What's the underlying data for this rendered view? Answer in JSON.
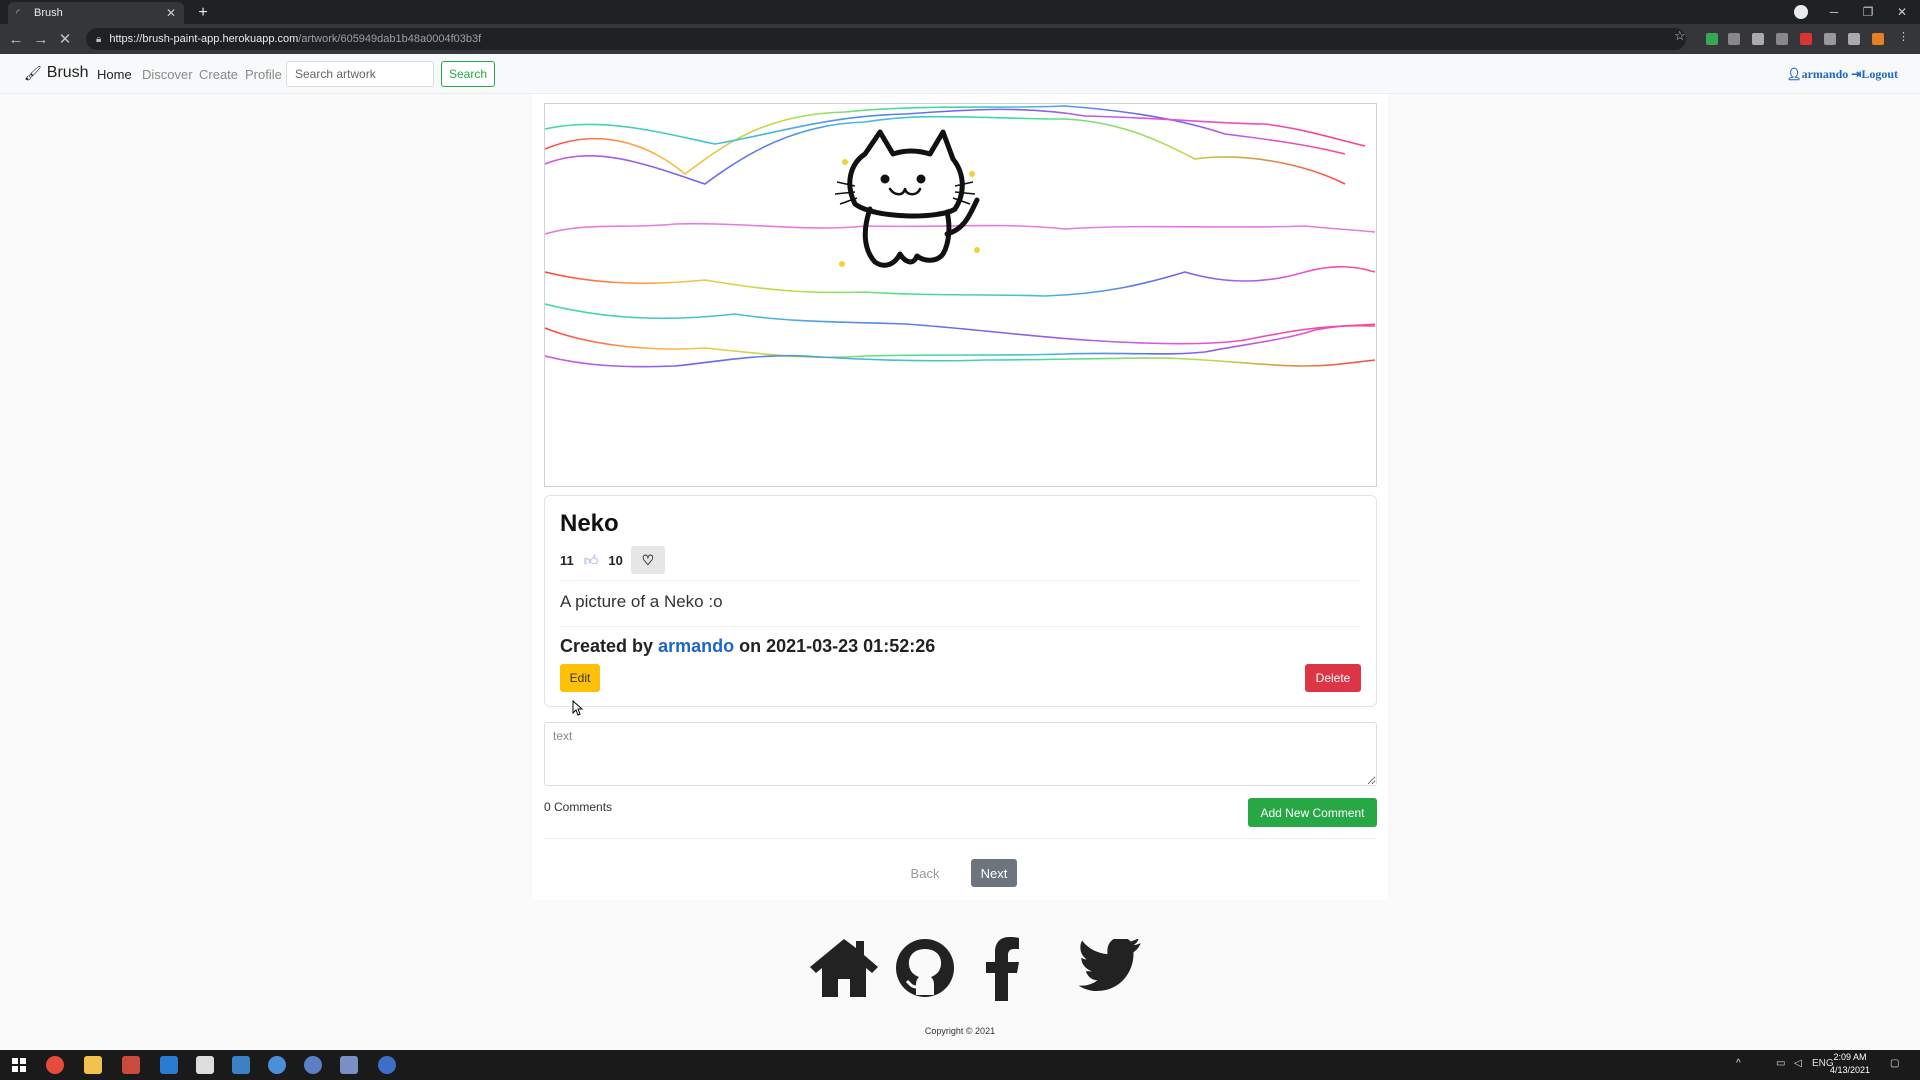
{
  "browser": {
    "tab_title": "Brush",
    "url_main": "https://brush-paint-app.herokuapp.com",
    "url_path": "/artwork/605949dab1b48a0004f03b3f"
  },
  "nav": {
    "brand": "Brush",
    "links": [
      "Home",
      "Discover",
      "Create",
      "Profile"
    ],
    "search_placeholder": "Search artwork",
    "search_button": "Search",
    "user": "armando",
    "logout": "Logout"
  },
  "artwork": {
    "title": "Neko",
    "likes": "11",
    "favorites": "10",
    "description": "A picture of a Neko :o",
    "created_prefix": "Created by",
    "author": "armando",
    "created_on": "on 2021-03-23 01:52:26",
    "edit_label": "Edit",
    "delete_label": "Delete"
  },
  "comments": {
    "placeholder": "text",
    "count_label": "0 Comments",
    "add_button": "Add New Comment"
  },
  "pagination": {
    "back": "Back",
    "next": "Next"
  },
  "footer": {
    "icons": [
      "home-icon",
      "github-icon",
      "facebook-icon",
      "twitter-icon"
    ],
    "copyright": "Copyright © 2021"
  },
  "taskbar": {
    "lang": "ENG",
    "time": "2:09 AM",
    "date": "4/13/2021"
  },
  "colors": {
    "accent_green": "#28a745",
    "danger": "#dc3545",
    "warning": "#ffc107",
    "link": "#1e66c7"
  }
}
